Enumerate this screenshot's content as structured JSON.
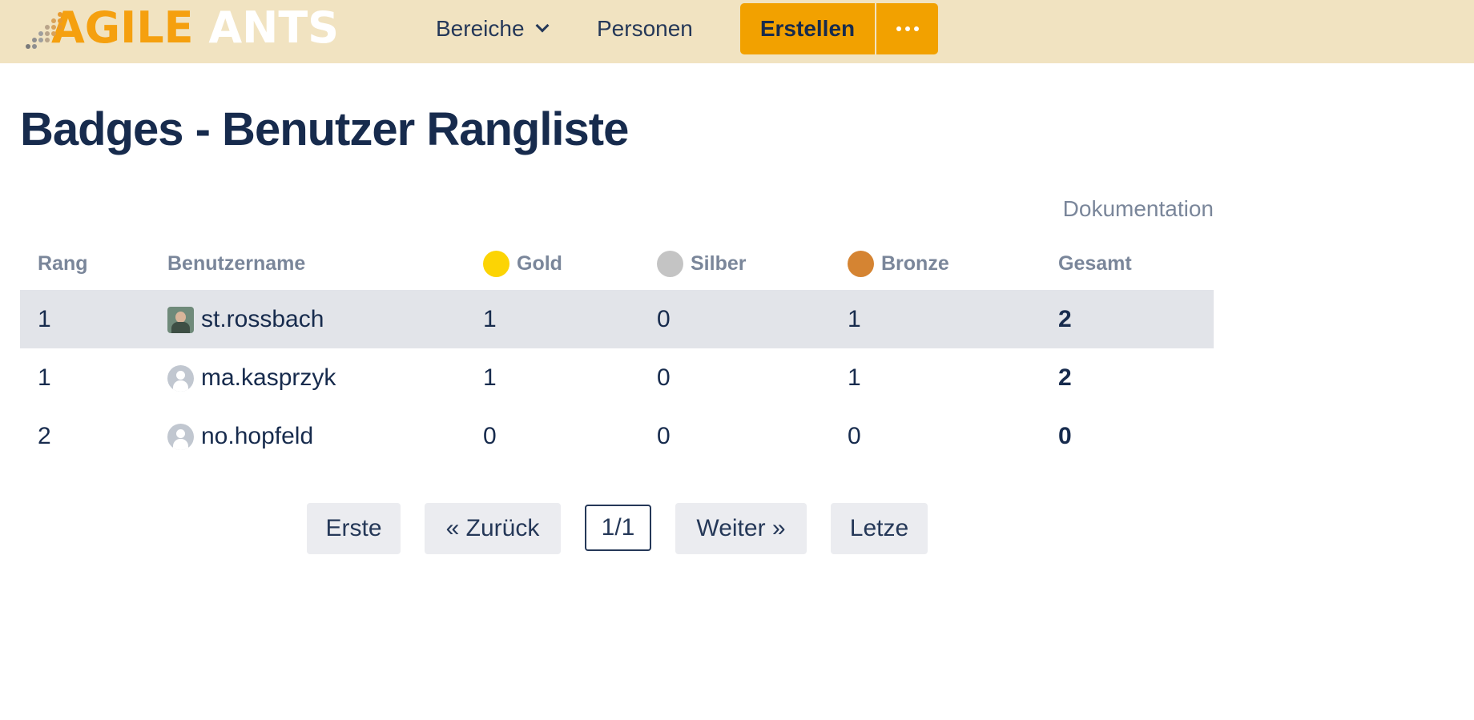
{
  "app": {
    "logo_part1": "AGILE",
    "logo_part2": "ANTS",
    "brand_color": "#f2a100"
  },
  "nav": {
    "bereiche": "Bereiche",
    "personen": "Personen",
    "create_label": "Erstellen",
    "more_icon": "more-dots-icon"
  },
  "page": {
    "title": "Badges - Benutzer Rangliste",
    "doc_link": "Dokumentation"
  },
  "table": {
    "headers": {
      "rang": "Rang",
      "benutzername": "Benutzername",
      "gold": "Gold",
      "silber": "Silber",
      "bronze": "Bronze",
      "gesamt": "Gesamt"
    },
    "medal_colors": {
      "gold": "#fcd404",
      "silber": "#c4c4c4",
      "bronze": "#d58432"
    },
    "rows": [
      {
        "rang": "1",
        "user": "st.rossbach",
        "gold": "1",
        "silber": "0",
        "bronze": "1",
        "gesamt": "2",
        "highlight": true,
        "avatar": "photo"
      },
      {
        "rang": "1",
        "user": "ma.kasprzyk",
        "gold": "1",
        "silber": "0",
        "bronze": "1",
        "gesamt": "2",
        "highlight": false,
        "avatar": "default-user-icon"
      },
      {
        "rang": "2",
        "user": "no.hopfeld",
        "gold": "0",
        "silber": "0",
        "bronze": "0",
        "gesamt": "0",
        "highlight": false,
        "avatar": "default-user-icon"
      }
    ]
  },
  "pagination": {
    "first": "Erste",
    "prev": "« Zurück",
    "current": "1/1",
    "next": "Weiter »",
    "last": "Letze"
  }
}
